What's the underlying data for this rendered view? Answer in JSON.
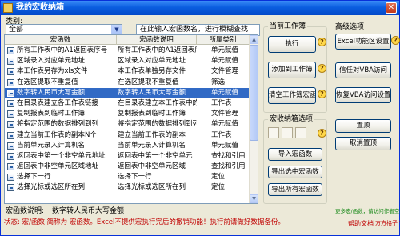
{
  "window": {
    "title": "我的宏收纳箱"
  },
  "category": {
    "label": "类别:",
    "value": "全部"
  },
  "search": {
    "placeholder": "在此输入宏函数名，进行模糊查找"
  },
  "table": {
    "columns": [
      "宏函数",
      "宏函数说明",
      "所属类别"
    ],
    "rows": [
      [
        "所有工作表中的A1返回表序号",
        "所有工作表中的A1返回表序号",
        "单元赋值"
      ],
      [
        "区域录入对应单元地址",
        "区域录入对应单元地址",
        "单元赋值"
      ],
      [
        "本工作表另存为xls文件",
        "本工作表单独另存文件",
        "文件管理"
      ],
      [
        "在选区提取不重复值",
        "在选区提取不重复值",
        "筛选"
      ],
      [
        "数字转人民币大写金额",
        "数字转人民币大写金额",
        "单元赋值"
      ],
      [
        "在目录表建立各工作表链接",
        "在目录表建立本工作表中的链接",
        "工作表"
      ],
      [
        "复制报表到临时工作簿",
        "复制报表到临时工作簿",
        "文件管理"
      ],
      [
        "将指定范围的数据排列到列",
        "将指定范围的数据排列到列",
        "单元赋值"
      ],
      [
        "建立当前工作表的副本N个",
        "建立当前工作表的副本",
        "工作表"
      ],
      [
        "当前单元录入计算机名",
        "当前单元录入计算机名",
        "单元赋值"
      ],
      [
        "返回表中第一个非空单元地址",
        "返回表中第一个非空单元",
        "查找和引用"
      ],
      [
        "返回表中非空单元区域地址",
        "返回表中非空单元区域",
        "查找和引用"
      ],
      [
        "选择下一行",
        "选择下一行",
        "定位"
      ],
      [
        "选择光标或选区所在列",
        "选择光标或选区所在列",
        "定位"
      ]
    ],
    "selected_index": 4
  },
  "macro_desc": {
    "label": "宏函数说明:",
    "value": "数字转人民币大写金额"
  },
  "status": {
    "label": "状态:",
    "text": "宏/函数 简称为 宏函数。Excel不提供宏执行完后的撤销功能！执行前请做好数据备份。"
  },
  "current_workbook": {
    "title": "当前工作簿",
    "execute": "执行",
    "add_to_workbook": "添加到工作簿",
    "clear_macros": "清空工作簿宏函数"
  },
  "macro_box": {
    "title": "宏收纳箱选项",
    "import": "导入宏函数",
    "export_selected": "导出选中宏函数",
    "export_all": "导出所有宏函数"
  },
  "advanced": {
    "title": "高级选项",
    "excel_settings": "Excel功能区设置",
    "trust_vba": "信任对VBA访问",
    "restore_vba": "恢复VBA访问设置"
  },
  "pin": {
    "pin": "置顶",
    "unpin": "取消置顶"
  },
  "links": {
    "more": "更多宏/函数，请访问作者空间",
    "help": "帮助文档",
    "author": "方方格子 V1.0"
  },
  "colors": {
    "title_blue": "#0a5ee0",
    "selection": "#316ac5",
    "status_red": "#c00000",
    "link_green": "#1b8a1b"
  }
}
